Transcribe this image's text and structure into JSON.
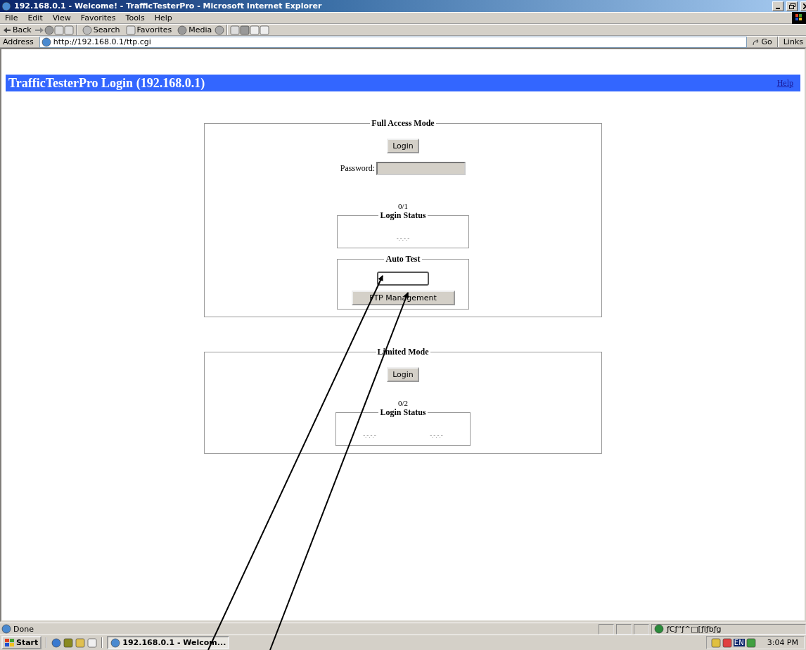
{
  "window": {
    "title": "192.168.0.1 - Welcome! - TrafficTesterPro - Microsoft Internet Explorer"
  },
  "menu": [
    "File",
    "Edit",
    "View",
    "Favorites",
    "Tools",
    "Help"
  ],
  "toolbar": {
    "back": "Back",
    "search": "Search",
    "favorites": "Favorites",
    "media": "Media"
  },
  "address_bar": {
    "label": "Address",
    "url": "http://192.168.0.1/ttp.cgi",
    "go": "Go",
    "links": "Links"
  },
  "page": {
    "header": {
      "title": "TrafficTesterPro Login  (192.168.0.1)",
      "help_link": "Help"
    },
    "full_access": {
      "title": "Full Access Mode",
      "login_button": "Login",
      "password": {
        "label": "Password:",
        "disabled": true
      },
      "counter": "0/1",
      "login_status": {
        "title": "Login Status",
        "entries": [
          "-.-.-.-"
        ]
      },
      "auto_test": {
        "title": "Auto Test",
        "button": "FTP Management"
      }
    },
    "limited_mode": {
      "title": "Limited Mode",
      "login_button": "Login",
      "counter": "0/2",
      "login_status": {
        "title": "Login Status",
        "entries": [
          "-.-.-.-",
          "-.-.-.-"
        ]
      }
    }
  },
  "status_bar": {
    "text": "Done",
    "zone": "ƒCƒ“ƒ^□[ƒlƒbƒg"
  },
  "taskbar": {
    "start": "Start",
    "task": "192.168.0.1 - Welcom...",
    "clock": "3:04 PM",
    "language": "EN"
  }
}
